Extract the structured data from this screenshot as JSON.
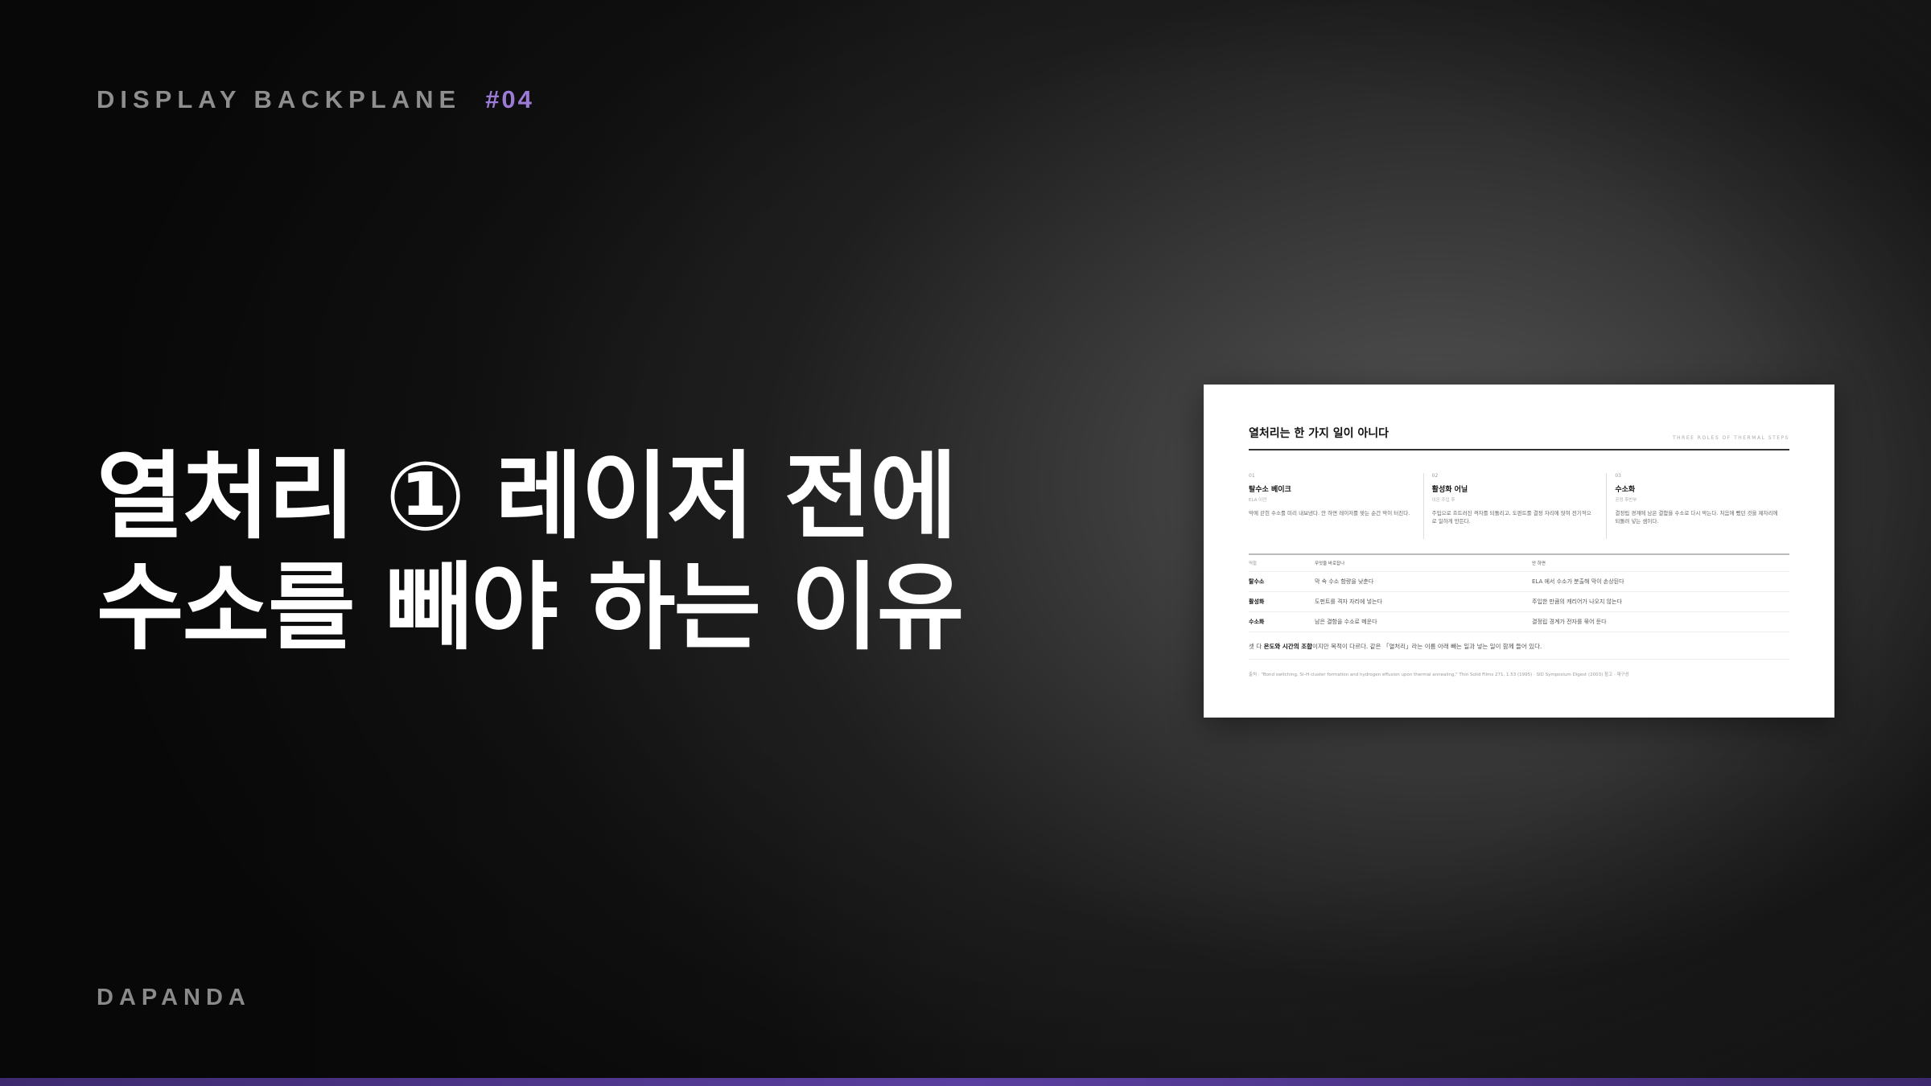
{
  "header": {
    "label": "DISPLAY BACKPLANE",
    "number": "#04"
  },
  "title": {
    "line1": "열처리 ① 레이저 전에",
    "line2": "수소를 빼야 하는 이유"
  },
  "brand": "DAPANDA",
  "colors": {
    "accent": "#9c7bd6",
    "strip": "#5b3fa0"
  },
  "card": {
    "title": "열처리는 한 가지 일이 아니다",
    "tag": "THREE ROLES OF THERMAL STEPS",
    "columns": [
      {
        "num": "01",
        "name": "탈수소 베이크",
        "sub": "ELA 이전",
        "desc": "막에 갇힌 수소를 미리 내보낸다. 안 하면 레이저를 맞는 순간 막이 터진다."
      },
      {
        "num": "02",
        "name": "활성화 어닐",
        "sub": "이온 주입 후",
        "desc": "주입으로 흐트러진 격자를 되돌리고, 도펀트를 결정 자리에 앉혀 전기적으로 일하게 만든다."
      },
      {
        "num": "03",
        "name": "수소화",
        "sub": "공정 후반부",
        "desc": "결정립 경계에 남은 결함을 수소로 다시 막는다. 처음에 뺐던 것을 제자리에 되돌려 넣는 셈이다."
      }
    ],
    "table": {
      "headers": [
        "역할",
        "무엇을 바로잡나",
        "안 하면"
      ],
      "rows": [
        [
          "탈수소",
          "막 속 수소 함량을 낮춘다",
          "ELA 에서 수소가 분출해 막이 손상된다"
        ],
        [
          "활성화",
          "도펀트를 격자 자리에 넣는다",
          "주입한 만큼의 캐리어가 나오지 않는다"
        ],
        [
          "수소화",
          "남은 결함을 수소로 메운다",
          "결정립 경계가 전자를 묶어 둔다"
        ]
      ]
    },
    "summary_pre": "셋 다 ",
    "summary_bold": "온도와 시간의 조합",
    "summary_post": "이지만 목적이 다르다. 같은 「열처리」라는 이름 아래 빼는 일과 넣는 일이 함께 들어 있다.",
    "source": "출처 · \"Bond switching, Si–H cluster formation and hydrogen effusion upon thermal annealing,\" Thin Solid Films 271, 1.53 (1995) · SID Symposium Digest (2003) 참고 · 재구성"
  }
}
